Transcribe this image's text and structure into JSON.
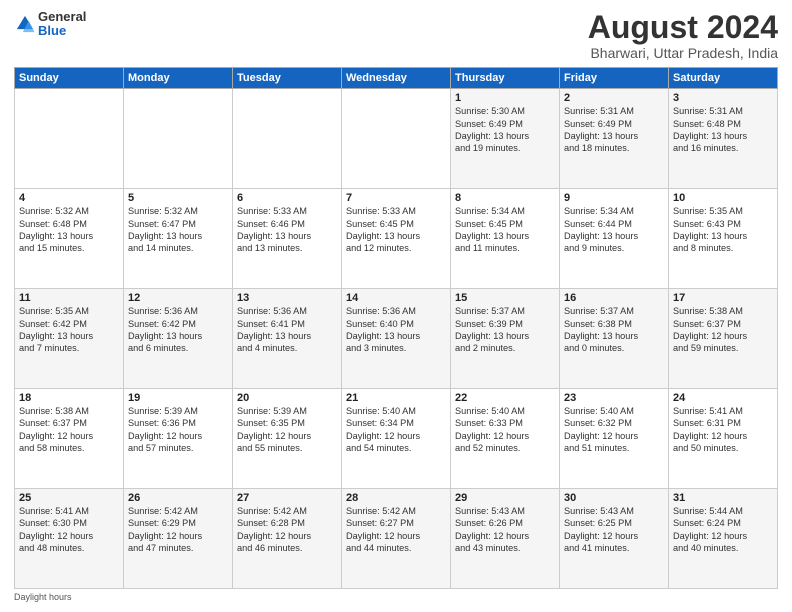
{
  "app": {
    "logo_line1": "General",
    "logo_line2": "Blue"
  },
  "header": {
    "title": "August 2024",
    "subtitle": "Bharwari, Uttar Pradesh, India"
  },
  "days_of_week": [
    "Sunday",
    "Monday",
    "Tuesday",
    "Wednesday",
    "Thursday",
    "Friday",
    "Saturday"
  ],
  "weeks": [
    [
      {
        "day": "",
        "info": ""
      },
      {
        "day": "",
        "info": ""
      },
      {
        "day": "",
        "info": ""
      },
      {
        "day": "",
        "info": ""
      },
      {
        "day": "1",
        "info": "Sunrise: 5:30 AM\nSunset: 6:49 PM\nDaylight: 13 hours\nand 19 minutes."
      },
      {
        "day": "2",
        "info": "Sunrise: 5:31 AM\nSunset: 6:49 PM\nDaylight: 13 hours\nand 18 minutes."
      },
      {
        "day": "3",
        "info": "Sunrise: 5:31 AM\nSunset: 6:48 PM\nDaylight: 13 hours\nand 16 minutes."
      }
    ],
    [
      {
        "day": "4",
        "info": "Sunrise: 5:32 AM\nSunset: 6:48 PM\nDaylight: 13 hours\nand 15 minutes."
      },
      {
        "day": "5",
        "info": "Sunrise: 5:32 AM\nSunset: 6:47 PM\nDaylight: 13 hours\nand 14 minutes."
      },
      {
        "day": "6",
        "info": "Sunrise: 5:33 AM\nSunset: 6:46 PM\nDaylight: 13 hours\nand 13 minutes."
      },
      {
        "day": "7",
        "info": "Sunrise: 5:33 AM\nSunset: 6:45 PM\nDaylight: 13 hours\nand 12 minutes."
      },
      {
        "day": "8",
        "info": "Sunrise: 5:34 AM\nSunset: 6:45 PM\nDaylight: 13 hours\nand 11 minutes."
      },
      {
        "day": "9",
        "info": "Sunrise: 5:34 AM\nSunset: 6:44 PM\nDaylight: 13 hours\nand 9 minutes."
      },
      {
        "day": "10",
        "info": "Sunrise: 5:35 AM\nSunset: 6:43 PM\nDaylight: 13 hours\nand 8 minutes."
      }
    ],
    [
      {
        "day": "11",
        "info": "Sunrise: 5:35 AM\nSunset: 6:42 PM\nDaylight: 13 hours\nand 7 minutes."
      },
      {
        "day": "12",
        "info": "Sunrise: 5:36 AM\nSunset: 6:42 PM\nDaylight: 13 hours\nand 6 minutes."
      },
      {
        "day": "13",
        "info": "Sunrise: 5:36 AM\nSunset: 6:41 PM\nDaylight: 13 hours\nand 4 minutes."
      },
      {
        "day": "14",
        "info": "Sunrise: 5:36 AM\nSunset: 6:40 PM\nDaylight: 13 hours\nand 3 minutes."
      },
      {
        "day": "15",
        "info": "Sunrise: 5:37 AM\nSunset: 6:39 PM\nDaylight: 13 hours\nand 2 minutes."
      },
      {
        "day": "16",
        "info": "Sunrise: 5:37 AM\nSunset: 6:38 PM\nDaylight: 13 hours\nand 0 minutes."
      },
      {
        "day": "17",
        "info": "Sunrise: 5:38 AM\nSunset: 6:37 PM\nDaylight: 12 hours\nand 59 minutes."
      }
    ],
    [
      {
        "day": "18",
        "info": "Sunrise: 5:38 AM\nSunset: 6:37 PM\nDaylight: 12 hours\nand 58 minutes."
      },
      {
        "day": "19",
        "info": "Sunrise: 5:39 AM\nSunset: 6:36 PM\nDaylight: 12 hours\nand 57 minutes."
      },
      {
        "day": "20",
        "info": "Sunrise: 5:39 AM\nSunset: 6:35 PM\nDaylight: 12 hours\nand 55 minutes."
      },
      {
        "day": "21",
        "info": "Sunrise: 5:40 AM\nSunset: 6:34 PM\nDaylight: 12 hours\nand 54 minutes."
      },
      {
        "day": "22",
        "info": "Sunrise: 5:40 AM\nSunset: 6:33 PM\nDaylight: 12 hours\nand 52 minutes."
      },
      {
        "day": "23",
        "info": "Sunrise: 5:40 AM\nSunset: 6:32 PM\nDaylight: 12 hours\nand 51 minutes."
      },
      {
        "day": "24",
        "info": "Sunrise: 5:41 AM\nSunset: 6:31 PM\nDaylight: 12 hours\nand 50 minutes."
      }
    ],
    [
      {
        "day": "25",
        "info": "Sunrise: 5:41 AM\nSunset: 6:30 PM\nDaylight: 12 hours\nand 48 minutes."
      },
      {
        "day": "26",
        "info": "Sunrise: 5:42 AM\nSunset: 6:29 PM\nDaylight: 12 hours\nand 47 minutes."
      },
      {
        "day": "27",
        "info": "Sunrise: 5:42 AM\nSunset: 6:28 PM\nDaylight: 12 hours\nand 46 minutes."
      },
      {
        "day": "28",
        "info": "Sunrise: 5:42 AM\nSunset: 6:27 PM\nDaylight: 12 hours\nand 44 minutes."
      },
      {
        "day": "29",
        "info": "Sunrise: 5:43 AM\nSunset: 6:26 PM\nDaylight: 12 hours\nand 43 minutes."
      },
      {
        "day": "30",
        "info": "Sunrise: 5:43 AM\nSunset: 6:25 PM\nDaylight: 12 hours\nand 41 minutes."
      },
      {
        "day": "31",
        "info": "Sunrise: 5:44 AM\nSunset: 6:24 PM\nDaylight: 12 hours\nand 40 minutes."
      }
    ]
  ],
  "footer": {
    "note": "Daylight hours"
  }
}
